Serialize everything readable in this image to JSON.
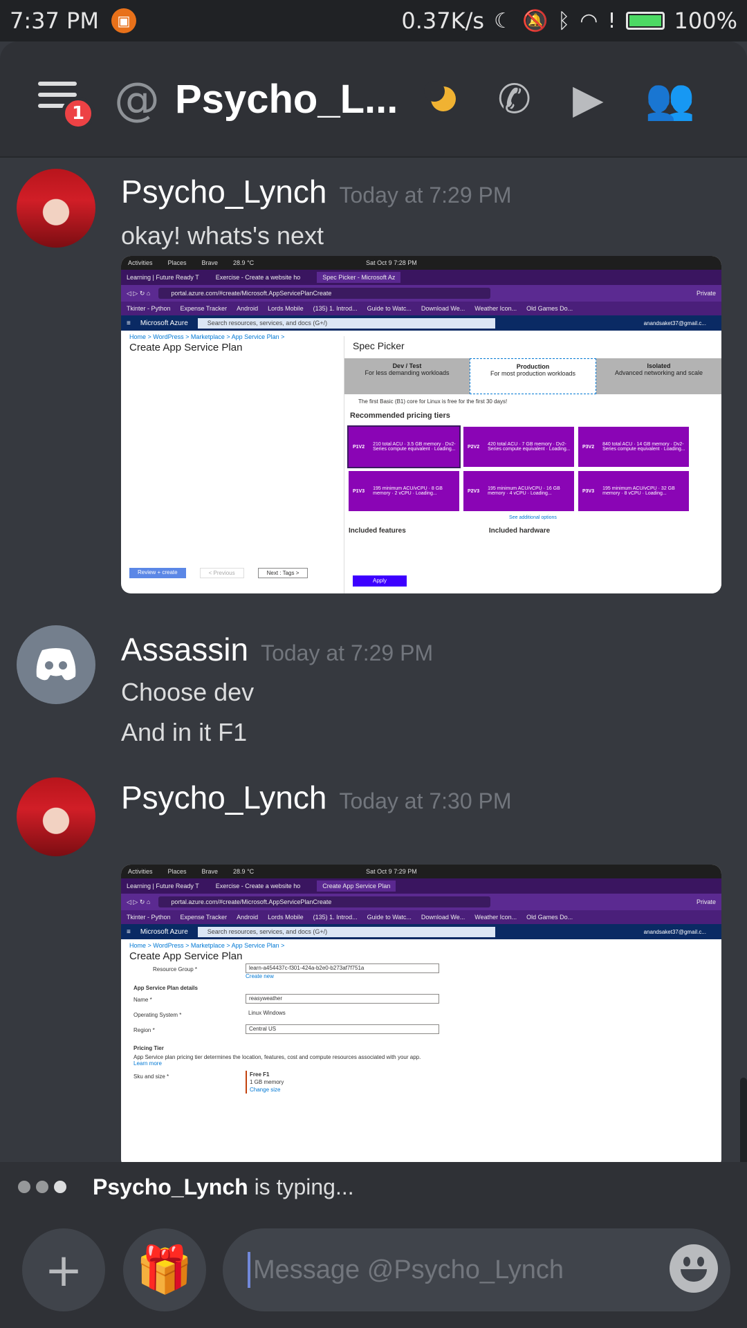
{
  "status_bar": {
    "time": "7:37 PM",
    "net_speed": "0.37K/s",
    "battery": "100%"
  },
  "header": {
    "title": "Psycho_L...",
    "notification_count": "1",
    "at_symbol": "@"
  },
  "messages": [
    {
      "author": "Psycho_Lynch",
      "time": "Today at 7:29 PM",
      "text": "okay! whats's next"
    },
    {
      "author": "Assassin",
      "time": "Today at 7:29 PM",
      "lines": [
        "Choose dev",
        "And in it F1"
      ]
    },
    {
      "author": "Psycho_Lynch",
      "time": "Today at 7:30 PM"
    }
  ],
  "screenshot1": {
    "gnome": [
      "Activities",
      "Places",
      "Brave",
      "28.9 °C",
      "Sat Oct 9  7:28 PM"
    ],
    "tabs": [
      "Learning | Future Ready T",
      "Exercise - Create a website ho",
      "Spec Picker - Microsoft Az"
    ],
    "url": "portal.azure.com/#create/Microsoft.AppServicePlanCreate",
    "private": "Private",
    "bookmarks": [
      "Tkinter - Python",
      "Expense Tracker",
      "Android",
      "Lords Mobile",
      "(135) 1. Introd...",
      "Guide to Watc...",
      "Download We...",
      "Weather Icon...",
      "Old Games Do..."
    ],
    "azure": "Microsoft Azure",
    "search": "Search resources, services, and docs (G+/)",
    "account": "anandsaket37@gmail.c...",
    "crumbs": "Home  >  WordPress  >  Marketplace  >  App Service Plan  >",
    "page_title": "Create App Service Plan",
    "spec_title": "Spec Picker",
    "spec_tabs": [
      {
        "name": "Dev / Test",
        "sub": "For less demanding workloads"
      },
      {
        "name": "Production",
        "sub": "For most production workloads"
      },
      {
        "name": "Isolated",
        "sub": "Advanced networking and scale"
      }
    ],
    "info": "The first Basic (B1) core for Linux is free for the first 30 days!",
    "recommended": "Recommended pricing tiers",
    "tiers": [
      {
        "code": "P1V2",
        "lines": "210 total ACU · 3.5 GB memory · Dv2-Series compute equivalent · Loading..."
      },
      {
        "code": "P2V2",
        "lines": "420 total ACU · 7 GB memory · Dv2-Series compute equivalent · Loading..."
      },
      {
        "code": "P3V2",
        "lines": "840 total ACU · 14 GB memory · Dv2-Series compute equivalent · Loading..."
      },
      {
        "code": "P1V3",
        "lines": "195 minimum ACU/vCPU · 8 GB memory · 2 vCPU · Loading..."
      },
      {
        "code": "P2V3",
        "lines": "195 minimum ACU/vCPU · 16 GB memory · 4 vCPU · Loading..."
      },
      {
        "code": "P3V3",
        "lines": "195 minimum ACU/vCPU · 32 GB memory · 8 vCPU · Loading..."
      }
    ],
    "see_more": "See additional options",
    "features": "Included features",
    "hardware": "Included hardware",
    "apply": "Apply",
    "review": "Review + create",
    "previous": "< Previous",
    "next": "Next : Tags >"
  },
  "screenshot2": {
    "gnome": [
      "Activities",
      "Places",
      "Brave",
      "28.9 °C",
      "Sat Oct 9  7:29 PM"
    ],
    "tabs": [
      "Learning | Future Ready T",
      "Exercise - Create a website ho",
      "Create App Service Plan"
    ],
    "url": "portal.azure.com/#create/Microsoft.AppServicePlanCreate",
    "crumbs": "Home  >  WordPress  >  Marketplace  >  App Service Plan  >",
    "page_title": "Create App Service Plan",
    "resource_group_label": "Resource Group *",
    "resource_group": "learn-a454437c-f301-424a-b2e0-b273af7f751a",
    "create_new": "Create new",
    "details": "App Service Plan details",
    "name_label": "Name *",
    "name": "reasyweather",
    "os_label": "Operating System *",
    "os": "Linux   Windows",
    "region_label": "Region *",
    "region": "Central US",
    "pricing": "Pricing Tier",
    "pricing_desc": "App Service plan pricing tier determines the location, features, cost and compute resources associated with your app.",
    "learn_more": "Learn more",
    "sku_label": "Sku and size *",
    "sku": "Free F1",
    "sku_mem": "1 GB memory",
    "change": "Change size"
  },
  "typing": {
    "user": "Psycho_Lynch",
    "suffix": "is typing..."
  },
  "input": {
    "placeholder": "Message @Psycho_Lynch"
  }
}
